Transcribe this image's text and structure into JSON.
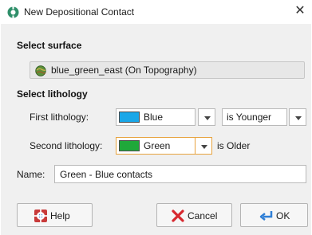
{
  "window": {
    "title": "New Depositional Contact",
    "close_glyph": "✕"
  },
  "surface_section": {
    "heading": "Select surface",
    "value": "blue_green_east (On Topography)"
  },
  "lithology_section": {
    "heading": "Select lithology",
    "first": {
      "label": "First lithology:",
      "value": "Blue",
      "color": "#1aa7e8",
      "relation": "is Younger"
    },
    "second": {
      "label": "Second lithology:",
      "value": "Green",
      "color": "#1fa83a",
      "relation": "is Older"
    }
  },
  "name_field": {
    "label": "Name:",
    "value": "Green - Blue contacts"
  },
  "buttons": {
    "help": "Help",
    "cancel": "Cancel",
    "ok": "OK"
  },
  "icons": {
    "app": "gear-pencil-icon",
    "surface": "globe-surface-icon",
    "help": "help-lifebuoy-icon",
    "cancel": "red-x-icon",
    "ok": "ok-arrow-icon"
  }
}
